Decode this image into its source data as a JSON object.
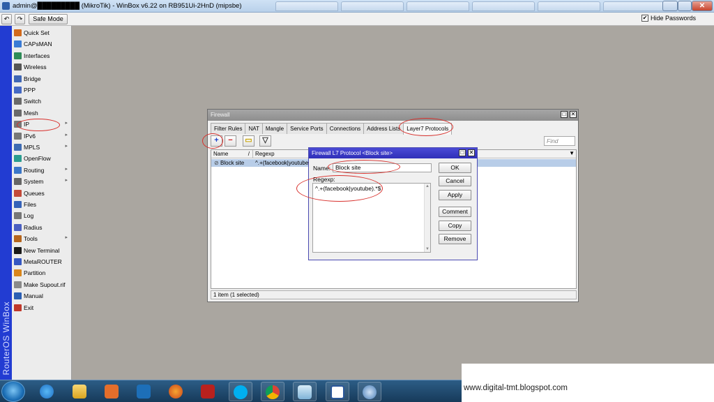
{
  "window": {
    "title": "admin@█████████ (MikroTik) - WinBox v6.22 on RB951Ui-2HnD (mipsbe)"
  },
  "toolbar": {
    "undo_label": "↶",
    "redo_label": "↷",
    "safe_mode_label": "Safe Mode",
    "hide_passwords_label": "Hide Passwords",
    "hide_passwords_checked": "✔"
  },
  "sidebar": {
    "brand": "RouterOS WinBox",
    "items": [
      {
        "label": "Quick Set",
        "icon": "quick-set-icon",
        "color": "#d26a1c",
        "submenu": ""
      },
      {
        "label": "CAPsMAN",
        "icon": "capsman-icon",
        "color": "#3a7bd5",
        "submenu": ""
      },
      {
        "label": "Interfaces",
        "icon": "interfaces-icon",
        "color": "#2e8b57",
        "submenu": ""
      },
      {
        "label": "Wireless",
        "icon": "wireless-icon",
        "color": "#555555",
        "submenu": ""
      },
      {
        "label": "Bridge",
        "icon": "bridge-icon",
        "color": "#3f66b5",
        "submenu": ""
      },
      {
        "label": "PPP",
        "icon": "ppp-icon",
        "color": "#4569c4",
        "submenu": ""
      },
      {
        "label": "Switch",
        "icon": "switch-icon",
        "color": "#6a6a6a",
        "submenu": ""
      },
      {
        "label": "Mesh",
        "icon": "mesh-icon",
        "color": "#6a6a6a",
        "submenu": ""
      },
      {
        "label": "IP",
        "icon": "ip-icon",
        "color": "#777777",
        "submenu": "▸"
      },
      {
        "label": "IPv6",
        "icon": "ipv6-icon",
        "color": "#777777",
        "submenu": "▸"
      },
      {
        "label": "MPLS",
        "icon": "mpls-icon",
        "color": "#3d6bb3",
        "submenu": "▸"
      },
      {
        "label": "OpenFlow",
        "icon": "openflow-icon",
        "color": "#2a9d8f",
        "submenu": ""
      },
      {
        "label": "Routing",
        "icon": "routing-icon",
        "color": "#3b77c8",
        "submenu": "▸"
      },
      {
        "label": "System",
        "icon": "system-icon",
        "color": "#666666",
        "submenu": "▸"
      },
      {
        "label": "Queues",
        "icon": "queues-icon",
        "color": "#c24a3a",
        "submenu": ""
      },
      {
        "label": "Files",
        "icon": "files-icon",
        "color": "#3562b8",
        "submenu": ""
      },
      {
        "label": "Log",
        "icon": "log-icon",
        "color": "#777777",
        "submenu": ""
      },
      {
        "label": "Radius",
        "icon": "radius-icon",
        "color": "#4a5fc1",
        "submenu": ""
      },
      {
        "label": "Tools",
        "icon": "tools-icon",
        "color": "#b5651d",
        "submenu": "▸"
      },
      {
        "label": "New Terminal",
        "icon": "terminal-icon",
        "color": "#1a1a1a",
        "submenu": ""
      },
      {
        "label": "MetaROUTER",
        "icon": "metarouter-icon",
        "color": "#3658c2",
        "submenu": ""
      },
      {
        "label": "Partition",
        "icon": "partition-icon",
        "color": "#d9861c",
        "submenu": ""
      },
      {
        "label": "Make Supout.rif",
        "icon": "supout-icon",
        "color": "#8a8a8a",
        "submenu": ""
      },
      {
        "label": "Manual",
        "icon": "manual-icon",
        "color": "#2b5fb4",
        "submenu": ""
      },
      {
        "label": "Exit",
        "icon": "exit-icon",
        "color": "#c0392b",
        "submenu": ""
      }
    ]
  },
  "firewall": {
    "title": "Firewall",
    "restore_label": "□",
    "close_label": "✕",
    "tabs": [
      "Filter Rules",
      "NAT",
      "Mangle",
      "Service Ports",
      "Connections",
      "Address Lists",
      "Layer7 Protocols"
    ],
    "actions": {
      "add": "+",
      "remove": "−",
      "comment": "▭",
      "filter": "▽"
    },
    "find_placeholder": "Find",
    "columns": {
      "name": "Name",
      "sort": "/",
      "regexp": "Regexp",
      "menu": "▼"
    },
    "rows": [
      {
        "marker": "⊘",
        "name": "Block site",
        "regexp": "^.+(facebook|youtube).*$"
      }
    ],
    "status": "1 item (1 selected)"
  },
  "l7_dialog": {
    "title": "Firewall L7 Protocol <Block site>",
    "restore_label": "□",
    "close_label": "✕",
    "name_label": "Name:",
    "name_value": "Block site",
    "regexp_label": "Regexp:",
    "regexp_value": "^.+(facebook|youtube).*$",
    "scroll_up": "▲",
    "scroll_down": "▼",
    "buttons": {
      "ok": "OK",
      "cancel": "Cancel",
      "apply": "Apply",
      "comment": "Comment",
      "copy": "Copy",
      "remove": "Remove"
    }
  },
  "taskbar": {
    "watermark": "www.digital-tmt.blogspot.com"
  },
  "colors": {
    "annotation": "#d8302c",
    "selected_row": "#b8cde8",
    "dialog_title": "#2f2fb8"
  }
}
